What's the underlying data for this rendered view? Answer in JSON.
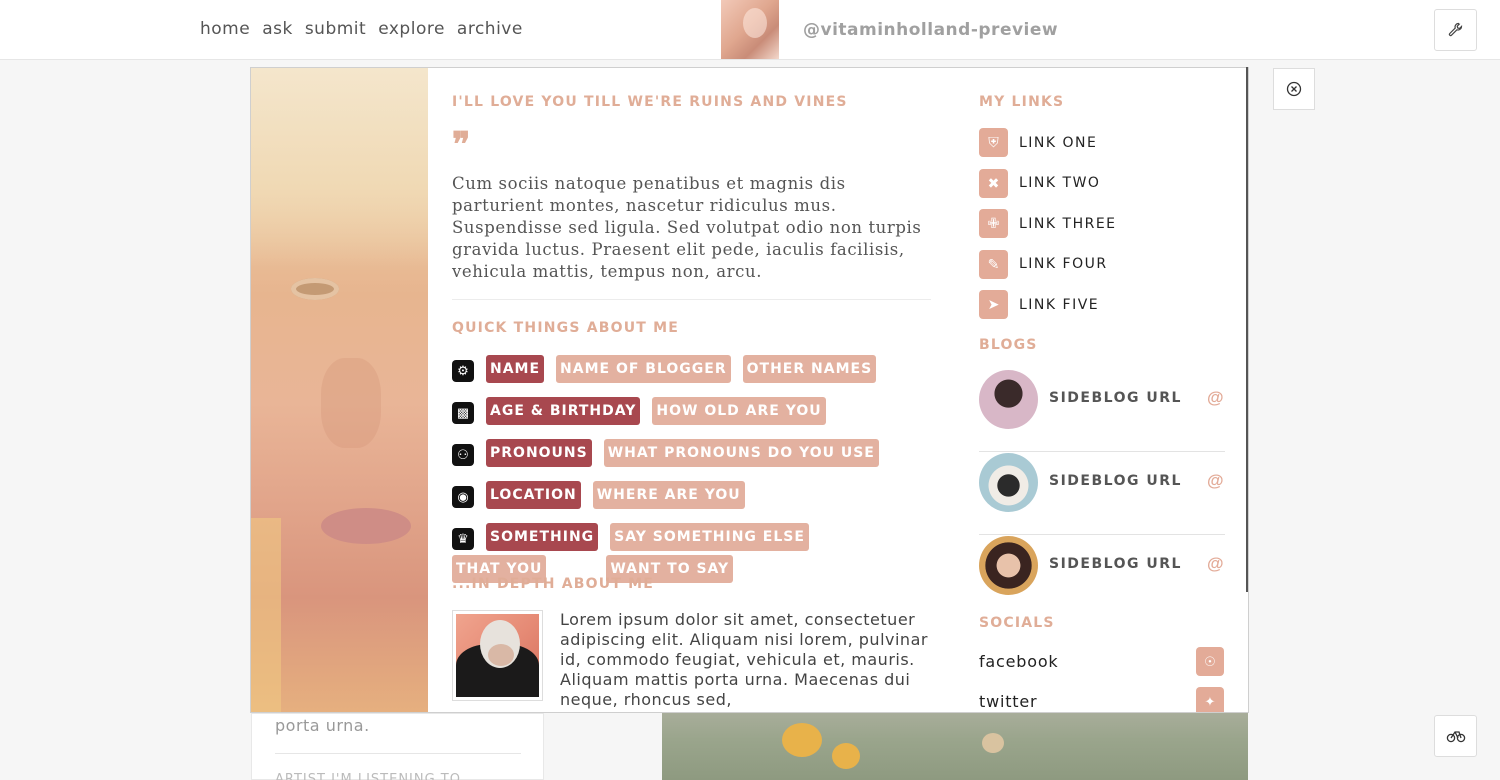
{
  "nav": {
    "items": [
      "home",
      "ask",
      "submit",
      "explore",
      "archive"
    ]
  },
  "header": {
    "blog_name": "@vitaminholland-preview"
  },
  "background": {
    "left_text": "porta urna.",
    "left_text2": "ARTIST I'M LISTENING TO"
  },
  "about": {
    "title": "I'LL LOVE YOU TILL WE'RE RUINS AND VINES",
    "quote_icon": "❞",
    "paragraph": "Cum sociis natoque penatibus et magnis dis parturient montes, nascetur ridiculus mus. Suspendisse sed ligula. Sed volutpat odio non turpis gravida luctus. Praesent elit pede, iaculis facilisis, vehicula mattis, tempus non, arcu.",
    "quick_title": "QUICK THINGS ABOUT ME",
    "quick": [
      {
        "icon": "user-icon",
        "label": "NAME",
        "values": [
          "NAME OF BLOGGER",
          "OTHER NAMES"
        ]
      },
      {
        "icon": "cake-icon",
        "label": "AGE & BIRTHDAY",
        "values": [
          "HOW OLD ARE YOU"
        ]
      },
      {
        "icon": "pronoun-icon",
        "label": "PRONOUNS",
        "values": [
          "WHAT PRONOUNS DO YOU USE"
        ]
      },
      {
        "icon": "globe-icon",
        "label": "LOCATION",
        "values": [
          "WHERE ARE YOU"
        ]
      },
      {
        "icon": "crown-icon",
        "label": "SOMETHING",
        "values": [
          "SAY SOMETHING ELSE",
          "THAT YOU",
          "WANT TO SAY"
        ]
      }
    ],
    "depth_title": "...IN DEPTH ABOUT ME",
    "bio": "Lorem ipsum dolor sit amet, consectetuer adipiscing elit. Aliquam nisi lorem, pulvinar id, commodo feugiat, vehicula et, mauris. Aliquam mattis porta urna. Maecenas dui neque, rhoncus sed,"
  },
  "links": {
    "title": "MY LINKS",
    "items": [
      {
        "icon": "shield-icon",
        "label": "LINK ONE"
      },
      {
        "icon": "cross-icon",
        "label": "LINK TWO"
      },
      {
        "icon": "bandage-icon",
        "label": "LINK THREE"
      },
      {
        "icon": "pen-icon",
        "label": "LINK FOUR"
      },
      {
        "icon": "rocket-icon",
        "label": "LINK FIVE"
      }
    ]
  },
  "blogs": {
    "title": "BLOGS",
    "items": [
      {
        "name": "SIDEBLOG URL",
        "avatar": "#c9a2b4"
      },
      {
        "name": "SIDEBLOG URL",
        "avatar": "#a9c6cf"
      },
      {
        "name": "SIDEBLOG URL",
        "avatar": "#d9a45c"
      }
    ],
    "at_icon": "@"
  },
  "socials": {
    "title": "SOCIALS",
    "items": [
      {
        "name": "facebook",
        "icon": "facebook-icon"
      },
      {
        "name": "twitter",
        "icon": "twitter-icon"
      }
    ]
  },
  "colors": {
    "accent": "#e0ad97",
    "tag_dark": "#a8484f",
    "tag_light": "#e3b1a0"
  }
}
